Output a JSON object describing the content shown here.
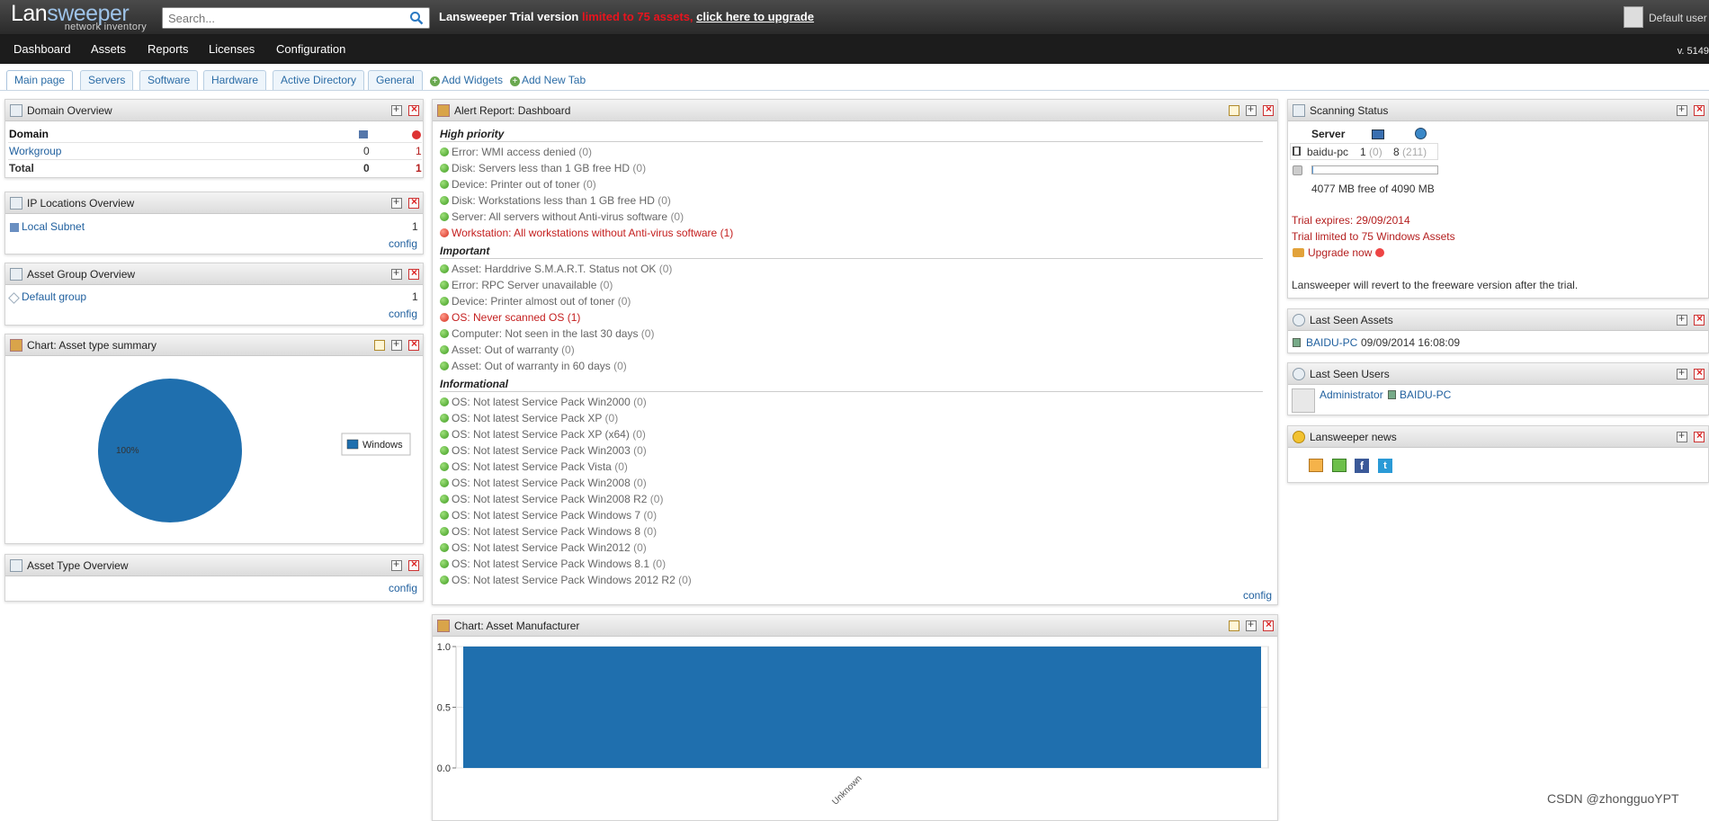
{
  "topbar": {
    "logo_main_a": "Lan",
    "logo_main_b": "sweeper",
    "logo_sub": "network inventory",
    "search_placeholder": "Search...",
    "trial_label": "Lansweeper Trial version",
    "trial_limit": "limited to 75 assets,",
    "trial_upgrade": "click here to upgrade",
    "user": "Default user"
  },
  "menu": [
    "Dashboard",
    "Assets",
    "Reports",
    "Licenses",
    "Configuration"
  ],
  "version": "v. 5149",
  "tabs": [
    "Main page",
    "Servers",
    "Software",
    "Hardware",
    "Active Directory",
    "General"
  ],
  "tab_actions": {
    "add_widgets": "Add Widgets",
    "add_tab": "Add New Tab"
  },
  "domain_overview": {
    "title": "Domain Overview",
    "header": "Domain",
    "rows": [
      {
        "name": "Workgroup",
        "a": "0",
        "b": "1"
      },
      {
        "name": "Total",
        "a": "0",
        "b": "1"
      }
    ]
  },
  "ip_locations": {
    "title": "IP Locations Overview",
    "item": "Local Subnet",
    "count": "1",
    "config": "config"
  },
  "asset_group": {
    "title": "Asset Group Overview",
    "item": "Default group",
    "count": "1",
    "config": "config"
  },
  "chart_asset_type": {
    "title": "Chart: Asset type summary",
    "legend": "Windows",
    "pct_label": "100%"
  },
  "asset_type_overview": {
    "title": "Asset Type Overview",
    "config": "config"
  },
  "alert_report": {
    "title": "Alert Report: Dashboard",
    "sections": [
      {
        "name": "High priority",
        "items": [
          {
            "text": "Error: WMI access denied",
            "count": "(0)",
            "status": "green"
          },
          {
            "text": "Disk: Servers less than 1 GB free HD",
            "count": "(0)",
            "status": "green"
          },
          {
            "text": "Device: Printer out of toner",
            "count": "(0)",
            "status": "green"
          },
          {
            "text": "Disk: Workstations less than 1 GB free HD",
            "count": "(0)",
            "status": "green"
          },
          {
            "text": "Server: All servers without Anti-virus software",
            "count": "(0)",
            "status": "green"
          },
          {
            "text": "Workstation: All workstations without Anti-virus software",
            "count": "(1)",
            "status": "red"
          }
        ]
      },
      {
        "name": "Important",
        "items": [
          {
            "text": "Asset: Harddrive S.M.A.R.T. Status not OK",
            "count": "(0)",
            "status": "green"
          },
          {
            "text": "Error: RPC Server unavailable",
            "count": "(0)",
            "status": "green"
          },
          {
            "text": "Device: Printer almost out of toner",
            "count": "(0)",
            "status": "green"
          },
          {
            "text": "OS: Never scanned OS",
            "count": "(1)",
            "status": "red"
          },
          {
            "text": "Computer: Not seen in the last 30 days",
            "count": "(0)",
            "status": "green"
          },
          {
            "text": "Asset: Out of warranty",
            "count": "(0)",
            "status": "green"
          },
          {
            "text": "Asset: Out of warranty in 60 days",
            "count": "(0)",
            "status": "green"
          }
        ]
      },
      {
        "name": "Informational",
        "items": [
          {
            "text": "OS: Not latest Service Pack Win2000",
            "count": "(0)",
            "status": "green"
          },
          {
            "text": "OS: Not latest Service Pack XP",
            "count": "(0)",
            "status": "green"
          },
          {
            "text": "OS: Not latest Service Pack XP (x64)",
            "count": "(0)",
            "status": "green"
          },
          {
            "text": "OS: Not latest Service Pack Win2003",
            "count": "(0)",
            "status": "green"
          },
          {
            "text": "OS: Not latest Service Pack Vista",
            "count": "(0)",
            "status": "green"
          },
          {
            "text": "OS: Not latest Service Pack Win2008",
            "count": "(0)",
            "status": "green"
          },
          {
            "text": "OS: Not latest Service Pack Win2008 R2",
            "count": "(0)",
            "status": "green"
          },
          {
            "text": "OS: Not latest Service Pack Windows 7",
            "count": "(0)",
            "status": "green"
          },
          {
            "text": "OS: Not latest Service Pack Windows 8",
            "count": "(0)",
            "status": "green"
          },
          {
            "text": "OS: Not latest Service Pack Win2012",
            "count": "(0)",
            "status": "green"
          },
          {
            "text": "OS: Not latest Service Pack Windows 8.1",
            "count": "(0)",
            "status": "green"
          },
          {
            "text": "OS: Not latest Service Pack Windows 2012 R2",
            "count": "(0)",
            "status": "green"
          }
        ]
      }
    ],
    "config": "config"
  },
  "chart_manufacturer": {
    "title": "Chart: Asset Manufacturer"
  },
  "scanning_status": {
    "title": "Scanning Status",
    "header": "Server",
    "server": "baidu-pc",
    "count1": "1",
    "count1b": "(0)",
    "count2": "8",
    "count2b": "(211)",
    "disk": "4077 MB free of 4090 MB",
    "trial_expires": "Trial expires: 29/09/2014",
    "trial_limited": "Trial limited to 75 Windows Assets",
    "upgrade": "Upgrade now",
    "revert": "Lansweeper will revert to the freeware version after the trial."
  },
  "last_seen_assets": {
    "title": "Last Seen Assets",
    "asset": "BAIDU-PC",
    "time": "09/09/2014 16:08:09"
  },
  "last_seen_users": {
    "title": "Last Seen Users",
    "user": "Administrator",
    "pc": "BAIDU-PC"
  },
  "news": {
    "title": "Lansweeper news"
  },
  "watermark": "CSDN @zhongguoYPT",
  "chart_data": [
    {
      "type": "pie",
      "title": "",
      "categories": [
        "Windows"
      ],
      "values": [
        100
      ],
      "labels": [
        "100%"
      ],
      "legend": "right"
    },
    {
      "type": "bar",
      "title": "",
      "categories": [
        "Unknown"
      ],
      "values": [
        1.0
      ],
      "ylim": [
        0,
        1.0
      ],
      "yticks": [
        "1.0",
        "0.5",
        "0.0"
      ],
      "xlabel": "",
      "ylabel": ""
    }
  ]
}
